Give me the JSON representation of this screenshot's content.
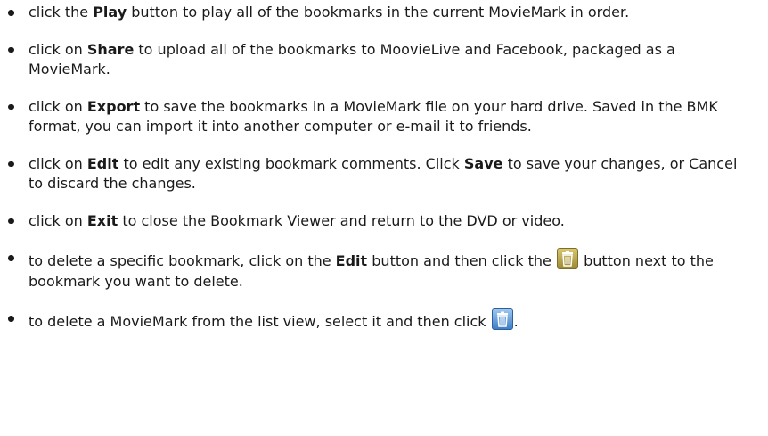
{
  "items": [
    {
      "pre": "click the ",
      "bold": "Play",
      "post": " button to play all of the bookmarks in the current MovieMark in order."
    },
    {
      "pre": "click on ",
      "bold": "Share",
      "post": " to upload all of the bookmarks to MoovieLive and Facebook, packaged as a MovieMark."
    },
    {
      "pre": "click on ",
      "bold": "Export",
      "post": " to save the bookmarks in a MovieMark file on your hard drive. Saved in the BMK format, you can import it into another computer or e-mail it to friends."
    },
    {
      "pre": "click on ",
      "bold": "Edit",
      "mid": " to edit any existing bookmark comments. Click ",
      "bold2": "Save",
      "post": " to save your changes, or Cancel to discard the changes."
    },
    {
      "pre": "click on ",
      "bold": "Exit",
      "post": " to close the Bookmark Viewer and return to the DVD or video."
    },
    {
      "pre": "to delete a specific bookmark, click on the ",
      "bold": "Edit",
      "mid": " button and then click the ",
      "post": " button next to the bookmark you want to delete.",
      "icon": "trash-icon-olive"
    },
    {
      "pre": "to delete a MovieMark from the list view, select it and then click ",
      "post": ".",
      "icon": "trash-icon-blue"
    }
  ]
}
